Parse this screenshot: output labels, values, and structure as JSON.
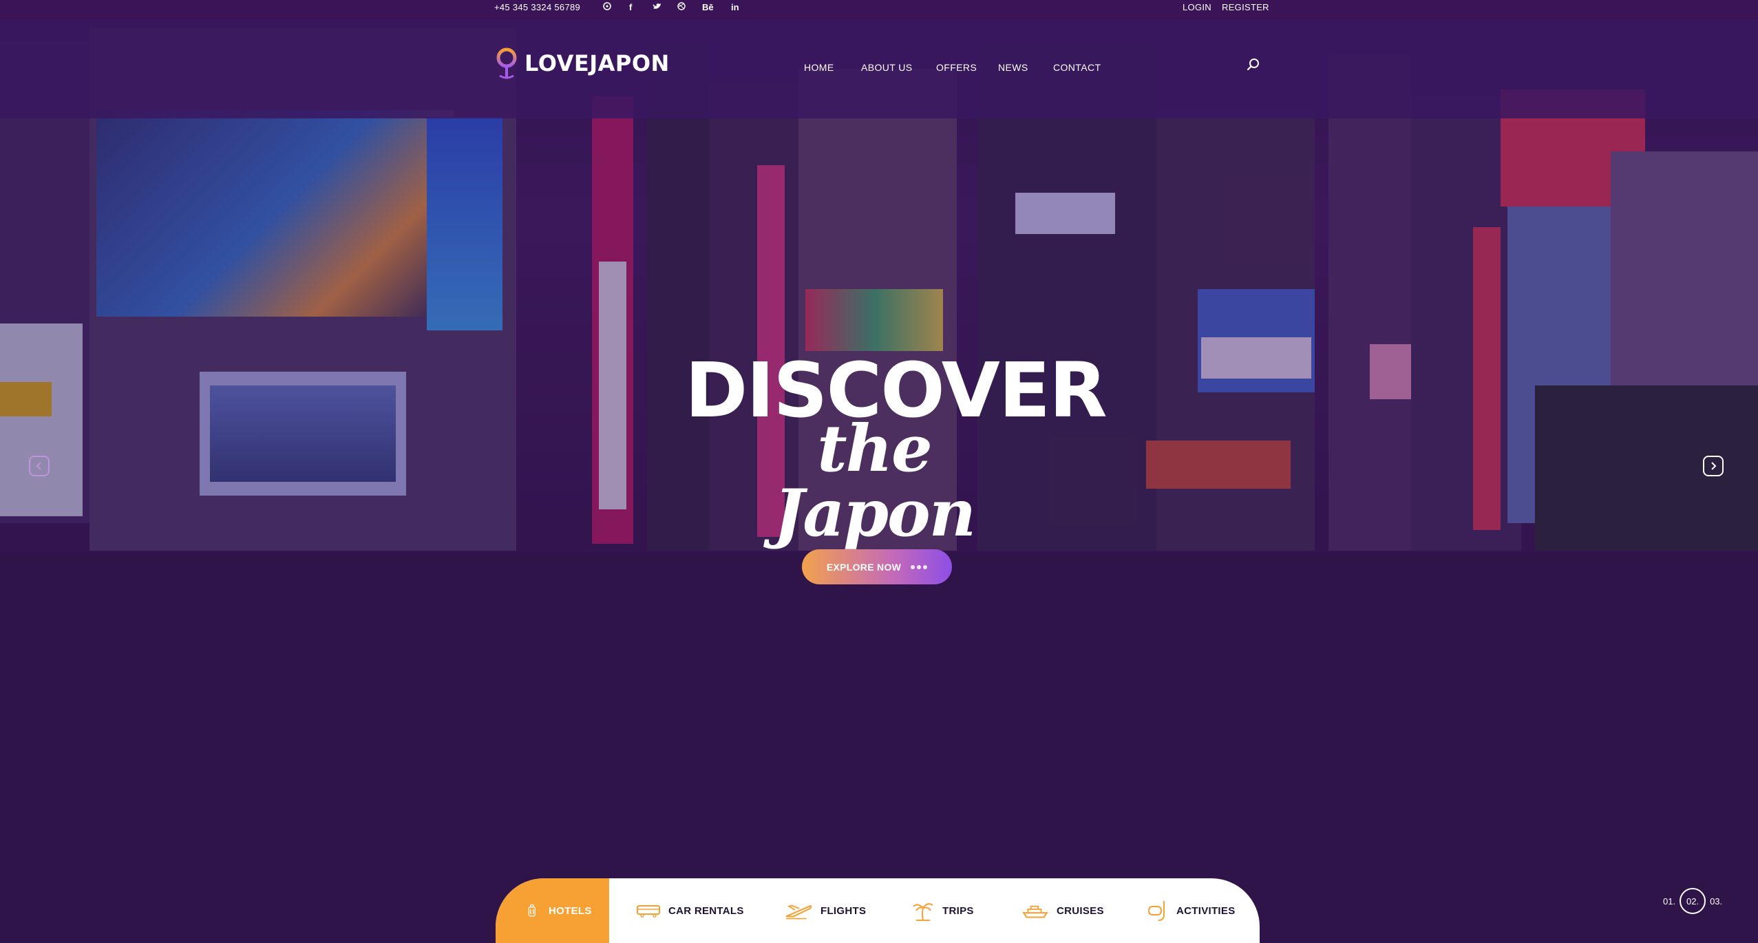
{
  "topbar": {
    "phone": "+45 345 3324 56789",
    "social_icons": [
      "pinterest-icon",
      "facebook-icon",
      "twitter-icon",
      "dribbble-icon",
      "behance-icon",
      "linkedin-icon"
    ],
    "behance_label": "Bē",
    "linkedin_label": "in",
    "facebook_label": "f",
    "login": "LOGIN",
    "register": "REGISTER"
  },
  "logo": {
    "text": "LOVEJAPON"
  },
  "nav": {
    "items": [
      "HOME",
      "ABOUT US",
      "OFFERS",
      "NEWS",
      "CONTACT"
    ]
  },
  "hero": {
    "headline": "DISCOVER",
    "subheadline": "the Japon",
    "cta": "EXPLORE NOW"
  },
  "pager": {
    "slides": [
      "01.",
      "02.",
      "03."
    ],
    "active_index": 1
  },
  "tabs": {
    "items": [
      {
        "label": "HOTELS",
        "icon": "luggage-icon",
        "active": true
      },
      {
        "label": "CAR RENTALS",
        "icon": "bus-icon",
        "active": false
      },
      {
        "label": "FLIGHTS",
        "icon": "airplane-icon",
        "active": false
      },
      {
        "label": "TRIPS",
        "icon": "palm-tree-icon",
        "active": false
      },
      {
        "label": "CRUISES",
        "icon": "ship-icon",
        "active": false
      },
      {
        "label": "ACTIVITIES",
        "icon": "snorkel-icon",
        "active": false
      }
    ]
  },
  "colors": {
    "page_bg": "#2e1449",
    "topbar_bg": "#3a1457",
    "accent_orange": "#f7a033",
    "accent_purple": "#8e4fe6",
    "tab_text": "#1f1233"
  }
}
